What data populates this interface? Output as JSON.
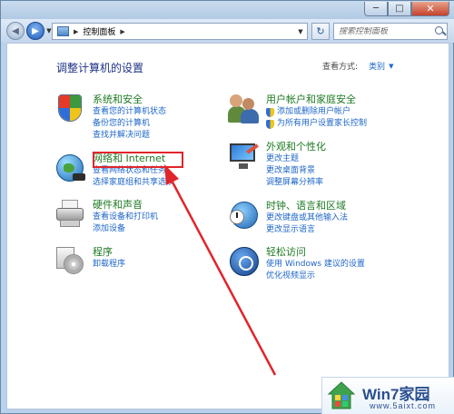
{
  "window": {
    "minimize_glyph": "─",
    "maximize_glyph": "□",
    "close_glyph": "✕"
  },
  "nav": {
    "address_path": "控制面板",
    "search_placeholder": "搜索控制面板",
    "refresh_glyph": "↻"
  },
  "content": {
    "heading": "调整计算机的设置",
    "view_by_label": "查看方式:",
    "view_by_value": "类别"
  },
  "categories": {
    "system_security": {
      "title": "系统和安全",
      "links": [
        "查看您的计算机状态",
        "备份您的计算机",
        "查找并解决问题"
      ],
      "icon": "security-shield-icon"
    },
    "network_internet": {
      "title": "网络和 Internet",
      "links": [
        "查看网络状态和任务",
        "选择家庭组和共享选项"
      ],
      "icon": "network-globe-icon"
    },
    "hardware_sound": {
      "title": "硬件和声音",
      "links": [
        "查看设备和打印机",
        "添加设备"
      ],
      "icon": "printer-icon"
    },
    "programs": {
      "title": "程序",
      "links": [
        "卸载程序"
      ],
      "icon": "programs-disc-icon"
    },
    "user_accounts": {
      "title": "用户帐户和家庭安全",
      "links": [
        "添加或删除用户帐户",
        "为所有用户设置家长控制"
      ],
      "icon": "users-icon"
    },
    "appearance": {
      "title": "外观和个性化",
      "links": [
        "更改主题",
        "更改桌面背景",
        "调整屏幕分辨率"
      ],
      "icon": "monitor-paint-icon"
    },
    "clock_language": {
      "title": "时钟、语言和区域",
      "links": [
        "更改键盘或其他输入法",
        "更改显示语言"
      ],
      "icon": "clock-globe-icon"
    },
    "ease_access": {
      "title": "轻松访问",
      "links": [
        "使用 Windows 建议的设置",
        "优化视频显示"
      ],
      "icon": "ease-of-access-icon"
    }
  },
  "annotation": {
    "highlight_color": "#e0252b"
  },
  "watermark": {
    "title": "Win7家园",
    "subtitle": "www.5aixt.com"
  }
}
